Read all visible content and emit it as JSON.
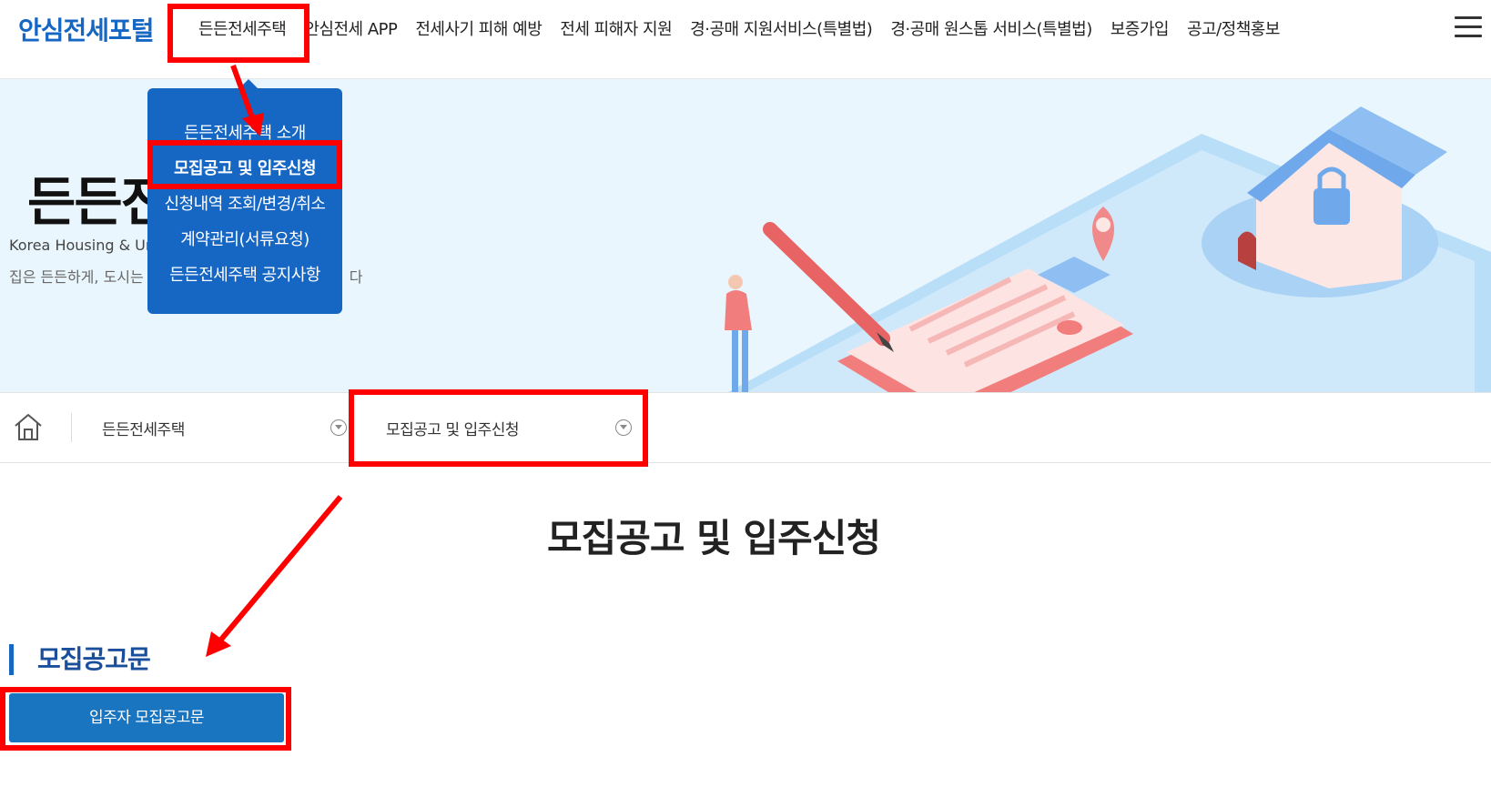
{
  "header": {
    "logo": "안심전세포털",
    "nav": [
      {
        "label": "든든전세주택"
      },
      {
        "label": "안심전세 APP"
      },
      {
        "label": "전세사기 피해 예방"
      },
      {
        "label": "전세 피해자 지원"
      },
      {
        "label": "경·공매 지원서비스(특별법)"
      },
      {
        "label": "경·공매 원스톱 서비스(특별법)"
      },
      {
        "label": "보증가입"
      },
      {
        "label": "공고/정책홍보"
      }
    ],
    "menu_icon": "hamburger-menu-icon"
  },
  "hero": {
    "title": "든든전",
    "subtitle": "Korea Housing & Urb",
    "description": "집은 든든하게, 도시는",
    "description_tail": "다"
  },
  "dropdown": {
    "items": [
      {
        "label": "든든전세주택 소개"
      },
      {
        "label": "모집공고 및 입주신청"
      },
      {
        "label": "신청내역 조회/변경/취소"
      },
      {
        "label": "계약관리(서류요청)"
      },
      {
        "label": "든든전세주택 공지사항"
      }
    ],
    "active_index": 1
  },
  "breadcrumb": {
    "home_icon": "home-icon",
    "level1": "든든전세주택",
    "level2": "모집공고 및 입주신청"
  },
  "main": {
    "page_title": "모집공고 및 입주신청",
    "section_title": "모집공고문",
    "notice_button": "입주자 모집공고문"
  },
  "colors": {
    "brand": "#1666c4",
    "hero_bg": "#eaf6fd",
    "annotation": "#ff0000",
    "button": "#1a75c0"
  }
}
